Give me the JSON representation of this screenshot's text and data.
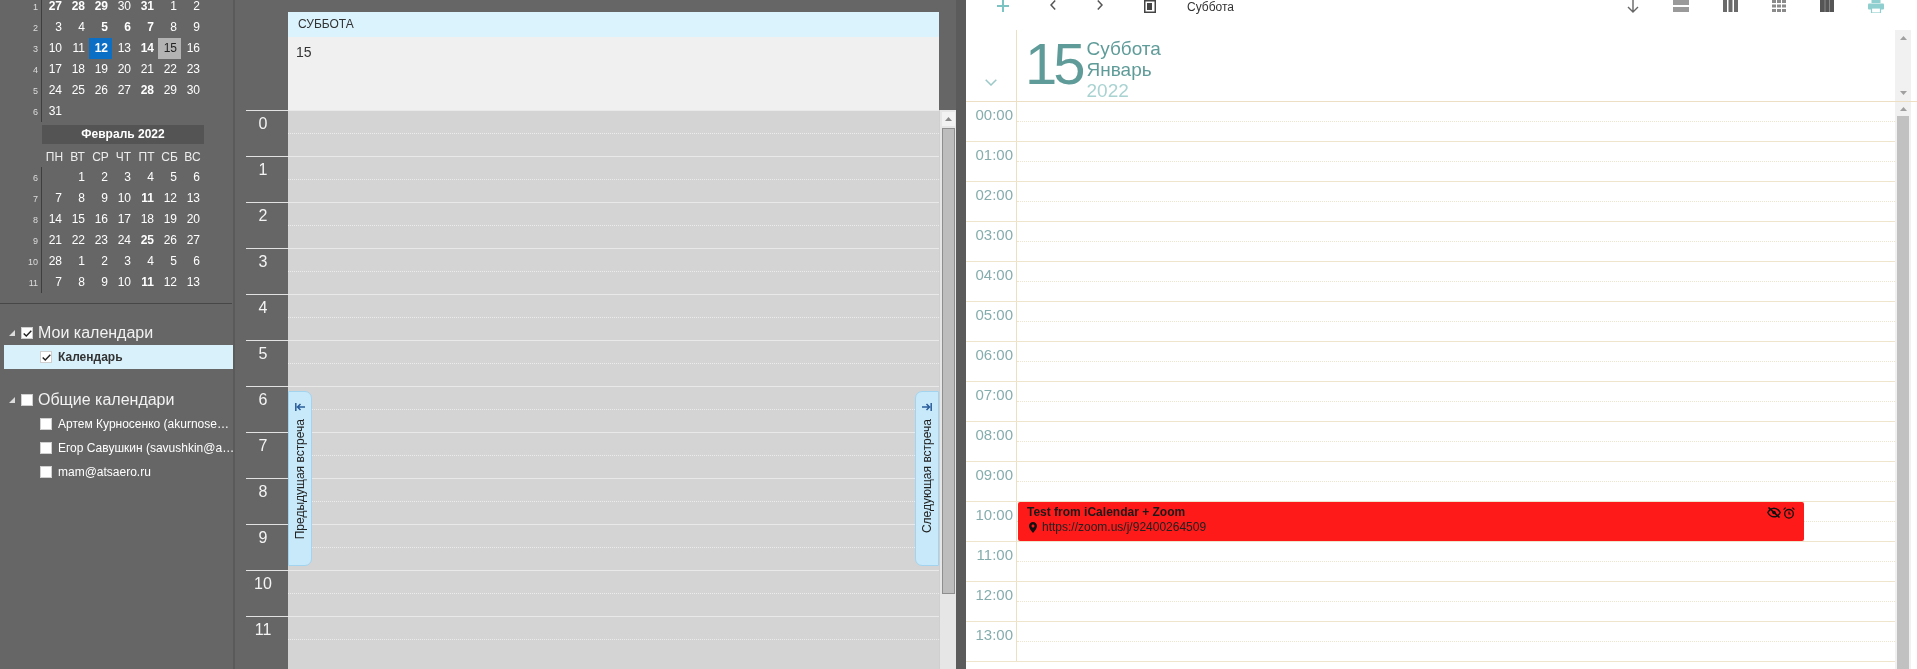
{
  "mini_calendar": {
    "months": [
      {
        "weeks": [
          {
            "number": "1",
            "days": [
              {
                "text": "27",
                "bold": true,
                "today": false,
                "selected": false
              },
              {
                "text": "28",
                "bold": true,
                "today": false,
                "selected": false
              },
              {
                "text": "29",
                "bold": true,
                "today": false,
                "selected": false
              },
              {
                "text": "30",
                "bold": false,
                "today": false,
                "selected": false
              },
              {
                "text": "31",
                "bold": true,
                "today": false,
                "selected": false
              },
              {
                "text": "1",
                "bold": false,
                "today": false,
                "selected": false
              },
              {
                "text": "2",
                "bold": false,
                "today": false,
                "selected": false
              }
            ]
          },
          {
            "number": "2",
            "days": [
              {
                "text": "3",
                "bold": false,
                "today": false,
                "selected": false
              },
              {
                "text": "4",
                "bold": false,
                "today": false,
                "selected": false
              },
              {
                "text": "5",
                "bold": true,
                "today": false,
                "selected": false
              },
              {
                "text": "6",
                "bold": true,
                "today": false,
                "selected": false
              },
              {
                "text": "7",
                "bold": true,
                "today": false,
                "selected": false
              },
              {
                "text": "8",
                "bold": false,
                "today": false,
                "selected": false
              },
              {
                "text": "9",
                "bold": false,
                "today": false,
                "selected": false
              }
            ]
          },
          {
            "number": "3",
            "days": [
              {
                "text": "10",
                "bold": false,
                "today": false,
                "selected": false
              },
              {
                "text": "11",
                "bold": false,
                "today": false,
                "selected": false
              },
              {
                "text": "12",
                "bold": true,
                "today": true,
                "selected": false
              },
              {
                "text": "13",
                "bold": false,
                "today": false,
                "selected": false
              },
              {
                "text": "14",
                "bold": true,
                "today": false,
                "selected": false
              },
              {
                "text": "15",
                "bold": false,
                "today": false,
                "selected": true
              },
              {
                "text": "16",
                "bold": false,
                "today": false,
                "selected": false
              }
            ]
          },
          {
            "number": "4",
            "days": [
              {
                "text": "17",
                "bold": false,
                "today": false,
                "selected": false
              },
              {
                "text": "18",
                "bold": false,
                "today": false,
                "selected": false
              },
              {
                "text": "19",
                "bold": false,
                "today": false,
                "selected": false
              },
              {
                "text": "20",
                "bold": false,
                "today": false,
                "selected": false
              },
              {
                "text": "21",
                "bold": false,
                "today": false,
                "selected": false
              },
              {
                "text": "22",
                "bold": false,
                "today": false,
                "selected": false
              },
              {
                "text": "23",
                "bold": false,
                "today": false,
                "selected": false
              }
            ]
          },
          {
            "number": "5",
            "days": [
              {
                "text": "24",
                "bold": false,
                "today": false,
                "selected": false
              },
              {
                "text": "25",
                "bold": false,
                "today": false,
                "selected": false
              },
              {
                "text": "26",
                "bold": false,
                "today": false,
                "selected": false
              },
              {
                "text": "27",
                "bold": false,
                "today": false,
                "selected": false
              },
              {
                "text": "28",
                "bold": true,
                "today": false,
                "selected": false
              },
              {
                "text": "29",
                "bold": false,
                "today": false,
                "selected": false
              },
              {
                "text": "30",
                "bold": false,
                "today": false,
                "selected": false
              }
            ]
          },
          {
            "number": "6",
            "days": [
              {
                "text": "31",
                "bold": false,
                "today": false,
                "selected": false
              }
            ]
          }
        ]
      },
      {
        "title": "Февраль 2022",
        "weekdays": [
          "ПН",
          "ВТ",
          "СР",
          "ЧТ",
          "ПТ",
          "СБ",
          "ВС"
        ],
        "weeks": [
          {
            "number": "6",
            "align_right": true,
            "days": [
              {
                "text": "1",
                "bold": false,
                "today": false,
                "selected": false
              },
              {
                "text": "2",
                "bold": false,
                "today": false,
                "selected": false
              },
              {
                "text": "3",
                "bold": false,
                "today": false,
                "selected": false
              },
              {
                "text": "4",
                "bold": false,
                "today": false,
                "selected": false
              },
              {
                "text": "5",
                "bold": false,
                "today": false,
                "selected": false
              },
              {
                "text": "6",
                "bold": false,
                "today": false,
                "selected": false
              }
            ]
          },
          {
            "number": "7",
            "days": [
              {
                "text": "7",
                "bold": false,
                "today": false,
                "selected": false
              },
              {
                "text": "8",
                "bold": false,
                "today": false,
                "selected": false
              },
              {
                "text": "9",
                "bold": false,
                "today": false,
                "selected": false
              },
              {
                "text": "10",
                "bold": false,
                "today": false,
                "selected": false
              },
              {
                "text": "11",
                "bold": true,
                "today": false,
                "selected": false
              },
              {
                "text": "12",
                "bold": false,
                "today": false,
                "selected": false
              },
              {
                "text": "13",
                "bold": false,
                "today": false,
                "selected": false
              }
            ]
          },
          {
            "number": "8",
            "days": [
              {
                "text": "14",
                "bold": false,
                "today": false,
                "selected": false
              },
              {
                "text": "15",
                "bold": false,
                "today": false,
                "selected": false
              },
              {
                "text": "16",
                "bold": false,
                "today": false,
                "selected": false
              },
              {
                "text": "17",
                "bold": false,
                "today": false,
                "selected": false
              },
              {
                "text": "18",
                "bold": false,
                "today": false,
                "selected": false
              },
              {
                "text": "19",
                "bold": false,
                "today": false,
                "selected": false
              },
              {
                "text": "20",
                "bold": false,
                "today": false,
                "selected": false
              }
            ]
          },
          {
            "number": "9",
            "days": [
              {
                "text": "21",
                "bold": false,
                "today": false,
                "selected": false
              },
              {
                "text": "22",
                "bold": false,
                "today": false,
                "selected": false
              },
              {
                "text": "23",
                "bold": false,
                "today": false,
                "selected": false
              },
              {
                "text": "24",
                "bold": false,
                "today": false,
                "selected": false
              },
              {
                "text": "25",
                "bold": true,
                "today": false,
                "selected": false
              },
              {
                "text": "26",
                "bold": false,
                "today": false,
                "selected": false
              },
              {
                "text": "27",
                "bold": false,
                "today": false,
                "selected": false
              }
            ]
          },
          {
            "number": "10",
            "days": [
              {
                "text": "28",
                "bold": false,
                "today": false,
                "selected": false
              },
              {
                "text": "1",
                "bold": false,
                "today": false,
                "selected": false
              },
              {
                "text": "2",
                "bold": false,
                "today": false,
                "selected": false
              },
              {
                "text": "3",
                "bold": false,
                "today": false,
                "selected": false
              },
              {
                "text": "4",
                "bold": false,
                "today": false,
                "selected": false
              },
              {
                "text": "5",
                "bold": false,
                "today": false,
                "selected": false
              },
              {
                "text": "6",
                "bold": false,
                "today": false,
                "selected": false
              }
            ]
          },
          {
            "number": "11",
            "days": [
              {
                "text": "7",
                "bold": false,
                "today": false,
                "selected": false
              },
              {
                "text": "8",
                "bold": false,
                "today": false,
                "selected": false
              },
              {
                "text": "9",
                "bold": false,
                "today": false,
                "selected": false
              },
              {
                "text": "10",
                "bold": false,
                "today": false,
                "selected": false
              },
              {
                "text": "11",
                "bold": true,
                "today": false,
                "selected": false
              },
              {
                "text": "12",
                "bold": false,
                "today": false,
                "selected": false
              },
              {
                "text": "13",
                "bold": false,
                "today": false,
                "selected": false
              }
            ]
          }
        ]
      }
    ]
  },
  "calendar_groups": [
    {
      "label": "Мои календари",
      "expanded": true,
      "checked": true,
      "selected": false,
      "children": [
        {
          "label": "Календарь",
          "checked": true,
          "selected": true
        }
      ]
    },
    {
      "label": "Общие календари",
      "expanded": true,
      "checked": false,
      "selected": false,
      "children": [
        {
          "label": "Артем Курносенко (akurnose…",
          "checked": false,
          "selected": false
        },
        {
          "label": "Егор Савушкин (savushkin@a…",
          "checked": false,
          "selected": false
        },
        {
          "label": "mam@atsaero.ru",
          "checked": false,
          "selected": false
        }
      ]
    }
  ],
  "day_view": {
    "day_name": "СУББОТА",
    "date": "15",
    "hours": [
      "0",
      "1",
      "2",
      "3",
      "4",
      "5",
      "6",
      "7",
      "8",
      "9",
      "10",
      "11"
    ],
    "previous_tab": "Предыдущая встреча",
    "next_tab": "Следующая встреча"
  },
  "agenda": {
    "toolbar_label": "Суббота",
    "day": "15",
    "weekday": "Суббота",
    "month": "Январь",
    "year": "2022",
    "hours": [
      {
        "label": "00:00"
      },
      {
        "label": "01:00"
      },
      {
        "label": "02:00"
      },
      {
        "label": "03:00"
      },
      {
        "label": "04:00"
      },
      {
        "label": "05:00"
      },
      {
        "label": "06:00"
      },
      {
        "label": "07:00"
      },
      {
        "label": "08:00"
      },
      {
        "label": "09:00"
      },
      {
        "label": "10:00",
        "events": [
          {
            "title": "Test from iCalendar + Zoom",
            "location": "https://zoom.us/j/92400264509",
            "color": "#ff1a1a",
            "private": true,
            "reminder": true
          }
        ]
      },
      {
        "label": "11:00"
      },
      {
        "label": "12:00"
      },
      {
        "label": "13:00"
      }
    ]
  }
}
